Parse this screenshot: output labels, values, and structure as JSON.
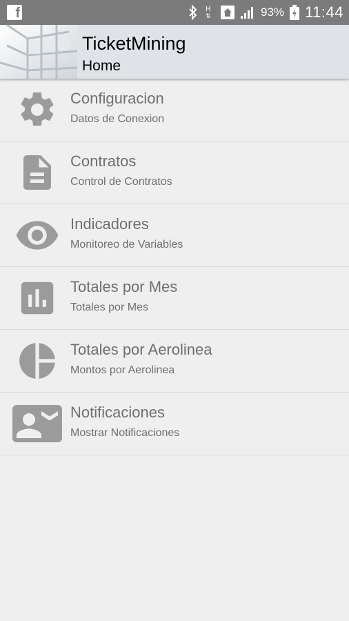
{
  "status_bar": {
    "battery_percent": "93%",
    "time": "11:44",
    "icons": [
      "facebook-icon",
      "bluetooth-icon",
      "signal-hplus-icon",
      "home-icon",
      "cell-signal-icon",
      "battery-charging-icon"
    ]
  },
  "header": {
    "title": "TicketMining",
    "subtitle": "Home"
  },
  "menu": [
    {
      "icon": "gear-icon",
      "title": "Configuracion",
      "subtitle": "Datos de Conexion"
    },
    {
      "icon": "document-icon",
      "title": "Contratos",
      "subtitle": "Control de Contratos"
    },
    {
      "icon": "eye-icon",
      "title": "Indicadores",
      "subtitle": "Monitoreo de Variables"
    },
    {
      "icon": "bar-chart-icon",
      "title": "Totales por Mes",
      "subtitle": "Totales por Mes"
    },
    {
      "icon": "pie-chart-icon",
      "title": "Totales por Aerolinea",
      "subtitle": "Montos por Aerolinea"
    },
    {
      "icon": "contact-mail-icon",
      "title": "Notificaciones",
      "subtitle": "Mostrar Notificaciones"
    }
  ],
  "colors": {
    "status_bar": "#7b7b7b",
    "header": "#dfe3e7",
    "background": "#efefef",
    "icon_gray": "#9b9b9b",
    "text_gray": "#6f6f6f"
  }
}
